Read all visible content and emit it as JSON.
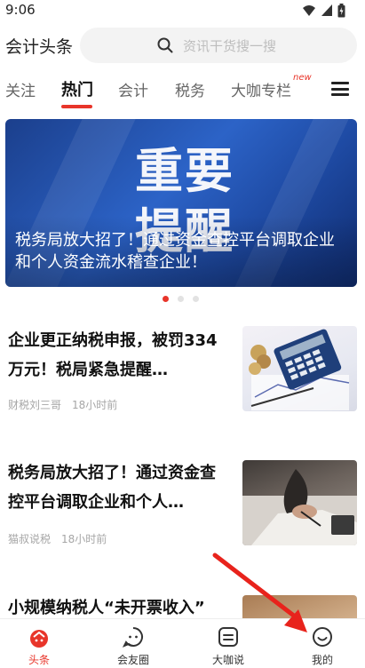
{
  "status_bar": {
    "time": "9:06"
  },
  "header": {
    "app_title": "会计头条",
    "search_placeholder": "资讯干货搜一搜"
  },
  "tabs": [
    {
      "label": "关注"
    },
    {
      "label": "热门"
    },
    {
      "label": "会计"
    },
    {
      "label": "税务"
    },
    {
      "label": "大咖专栏"
    }
  ],
  "new_badge": "new",
  "banner": {
    "line1": "重要",
    "line2": "提醒",
    "caption": "税务局放大招了！通过资金查控平台调取企业和个人资金流水稽查企业！"
  },
  "articles": [
    {
      "title": "企业更正纳税申报，被罚334万元！税局紧急提醒…",
      "author": "财税刘三哥",
      "time": "18小时前"
    },
    {
      "title": "税务局放大招了！通过资金查控平台调取企业和个人…",
      "author": "猫叔说税",
      "time": "18小时前"
    },
    {
      "title": "小规模纳税人“未开票收入”"
    }
  ],
  "bottom_nav": [
    {
      "label": "头条",
      "icon": "home-icon"
    },
    {
      "label": "会友圈",
      "icon": "chat-icon"
    },
    {
      "label": "大咖说",
      "icon": "message-square-icon"
    },
    {
      "label": "我的",
      "icon": "smile-face-icon"
    }
  ],
  "colors": {
    "accent": "#e8352a",
    "banner_blue": "#1e4aa3",
    "annotation_arrow": "#e8231c"
  }
}
